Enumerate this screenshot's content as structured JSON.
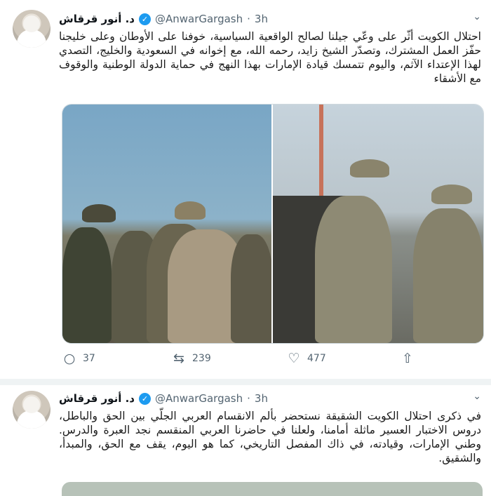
{
  "tweets": [
    {
      "name": "د. أنور قرقاش",
      "handle": "@AnwarGargash",
      "dot": "·",
      "time": "3h",
      "text": "احتلال الكويت أثّر على وعّي جيلنا لصالح الواقعية السياسية، خوفنا على الأوطان وعلى خليجنا حفّز العمل المشترك، وتصدّر الشيخ زايد، رحمه الله، مع إخوانه في السعودية والخليج، التصدي لهذا الإعتداء الآثم، واليوم تتمسك قيادة الإمارات بهذا النهج في حماية الدولة الوطنية والوقوف مع الأشقاء",
      "replies": "37",
      "retweets": "239",
      "likes": "477"
    },
    {
      "name": "د. أنور قرقاش",
      "handle": "@AnwarGargash",
      "dot": "·",
      "time": "3h",
      "text": "في ذكرى احتلال الكويت الشقيقة نستحضر بألم الانقسام العربي الجلّي بين الحق والباطل، دروس الاختبار العسير ماثلة أمامنا، ولعلنا في حاضرنا العربي المنقسم نجد العبرة والدرس. وطني الإمارات، وقيادته، في ذاك المفصل التاريخي، كما هو اليوم، يقف مع الحق، والمبدأ، والشقيق."
    }
  ],
  "icons": {
    "verified": "✓",
    "caret": "⌄",
    "reply": "○",
    "retweet": "⇆",
    "like": "♡",
    "share": "⇧"
  }
}
